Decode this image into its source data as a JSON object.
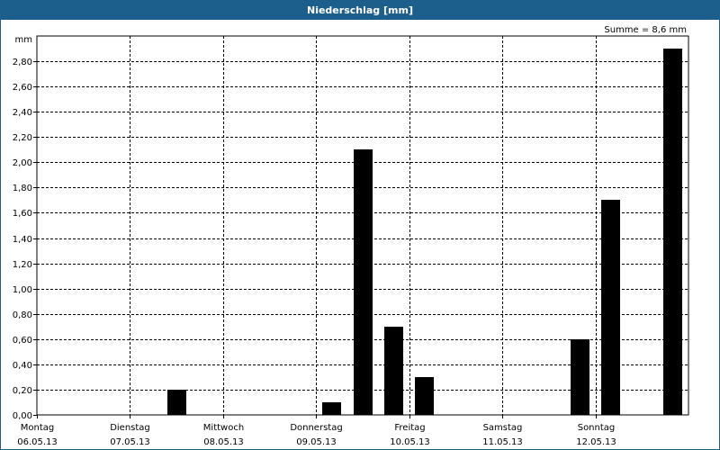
{
  "window": {
    "title": "Niederschlag [mm]"
  },
  "total_label": "Summe = 8,6 mm",
  "chart_data": {
    "type": "bar",
    "title": "Niederschlag [mm]",
    "ylabel": "mm",
    "xlabel": "",
    "ylim": [
      0,
      3.0
    ],
    "y_ticks": [
      "0,00",
      "0,20",
      "0,40",
      "0,60",
      "0,80",
      "1,00",
      "1,20",
      "1,40",
      "1,60",
      "1,80",
      "2,00",
      "2,20",
      "2,40",
      "2,60",
      "2,80"
    ],
    "days": [
      {
        "name": "Montag",
        "date": "06.05.13"
      },
      {
        "name": "Dienstag",
        "date": "07.05.13"
      },
      {
        "name": "Mittwoch",
        "date": "08.05.13"
      },
      {
        "name": "Donnerstag",
        "date": "09.05.13"
      },
      {
        "name": "Freitag",
        "date": "10.05.13"
      },
      {
        "name": "Samstag",
        "date": "11.05.13"
      },
      {
        "name": "Sonntag",
        "date": "12.05.13"
      }
    ],
    "bars": [
      {
        "day": 1,
        "slot": 1,
        "value": 0.2
      },
      {
        "day": 3,
        "slot": 0,
        "value": 0.1
      },
      {
        "day": 3,
        "slot": 1,
        "value": 2.1
      },
      {
        "day": 3,
        "slot": 2,
        "value": 0.7
      },
      {
        "day": 4,
        "slot": 0,
        "value": 0.3
      },
      {
        "day": 5,
        "slot": 2,
        "value": 0.6
      },
      {
        "day": 6,
        "slot": 0,
        "value": 1.7
      },
      {
        "day": 6,
        "slot": 2,
        "value": 2.9
      }
    ],
    "slots_per_day": 3,
    "bar_color": "#000000",
    "grid": true
  }
}
